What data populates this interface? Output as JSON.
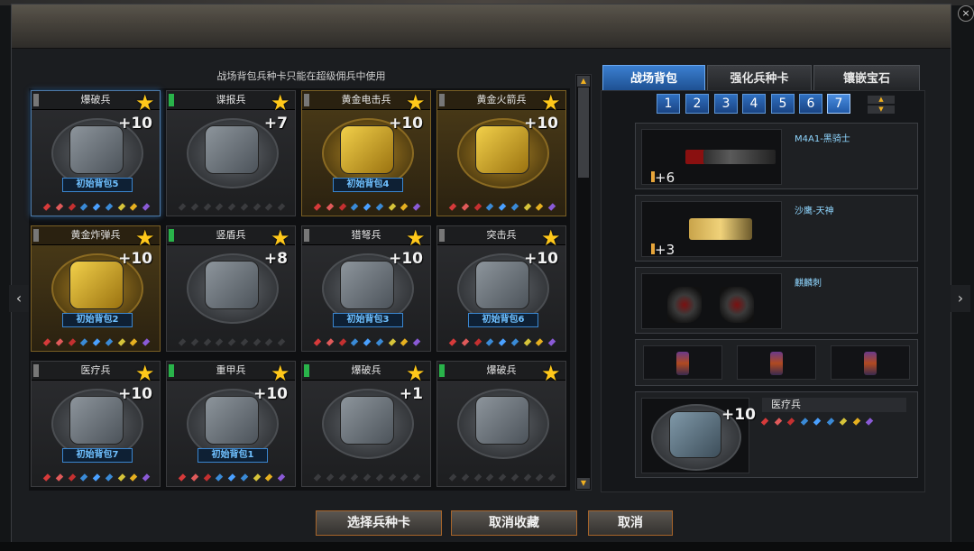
{
  "header": {
    "close_icon": "×"
  },
  "notice": "战场背包兵种卡只能在超级佣兵中使用",
  "nav": {
    "left_arrow": "‹",
    "right_arrow": "›"
  },
  "cards": [
    {
      "name": "爆破兵",
      "plus": "+10",
      "origin": "初始背包5",
      "tag": "grey",
      "style": "selected"
    },
    {
      "name": "谍报兵",
      "plus": "+7",
      "origin": "",
      "tag": "green",
      "style": "normal"
    },
    {
      "name": "黄金电击兵",
      "plus": "+10",
      "origin": "初始背包4",
      "tag": "grey",
      "style": "gold"
    },
    {
      "name": "黄金火箭兵",
      "plus": "+10",
      "origin": "",
      "tag": "grey",
      "style": "gold"
    },
    {
      "name": "黄金炸弹兵",
      "plus": "+10",
      "origin": "初始背包2",
      "tag": "grey",
      "style": "gold"
    },
    {
      "name": "竖盾兵",
      "plus": "+8",
      "origin": "",
      "tag": "green",
      "style": "normal"
    },
    {
      "name": "猎弩兵",
      "plus": "+10",
      "origin": "初始背包3",
      "tag": "grey",
      "style": "normal"
    },
    {
      "name": "突击兵",
      "plus": "+10",
      "origin": "初始背包6",
      "tag": "grey",
      "style": "normal"
    },
    {
      "name": "医疗兵",
      "plus": "+10",
      "origin": "初始背包7",
      "tag": "grey",
      "style": "normal"
    },
    {
      "name": "重甲兵",
      "plus": "+10",
      "origin": "初始背包1",
      "tag": "green",
      "style": "normal"
    },
    {
      "name": "爆破兵",
      "plus": "+1",
      "origin": "",
      "tag": "green",
      "style": "normal"
    },
    {
      "name": "爆破兵",
      "plus": "",
      "origin": "",
      "tag": "green",
      "style": "normal"
    }
  ],
  "tabs": [
    "战场背包",
    "强化兵种卡",
    "镶嵌宝石"
  ],
  "pages": [
    "1",
    "2",
    "3",
    "4",
    "5",
    "6",
    "7"
  ],
  "active_page": "7",
  "slots": [
    {
      "name": "M4A1-黑骑士",
      "count": "+6"
    },
    {
      "name": "沙鹰-天神",
      "count": "+3"
    },
    {
      "name": "麒麟刺",
      "count": ""
    }
  ],
  "equipped_card": {
    "name": "医疗兵",
    "plus": "+10"
  },
  "buttons": [
    "选择兵种卡",
    "取消收藏",
    "取消"
  ],
  "colors": {
    "accent_blue": "#2f6fc0",
    "gold": "#ffc81a",
    "button_border": "#a8652a"
  }
}
